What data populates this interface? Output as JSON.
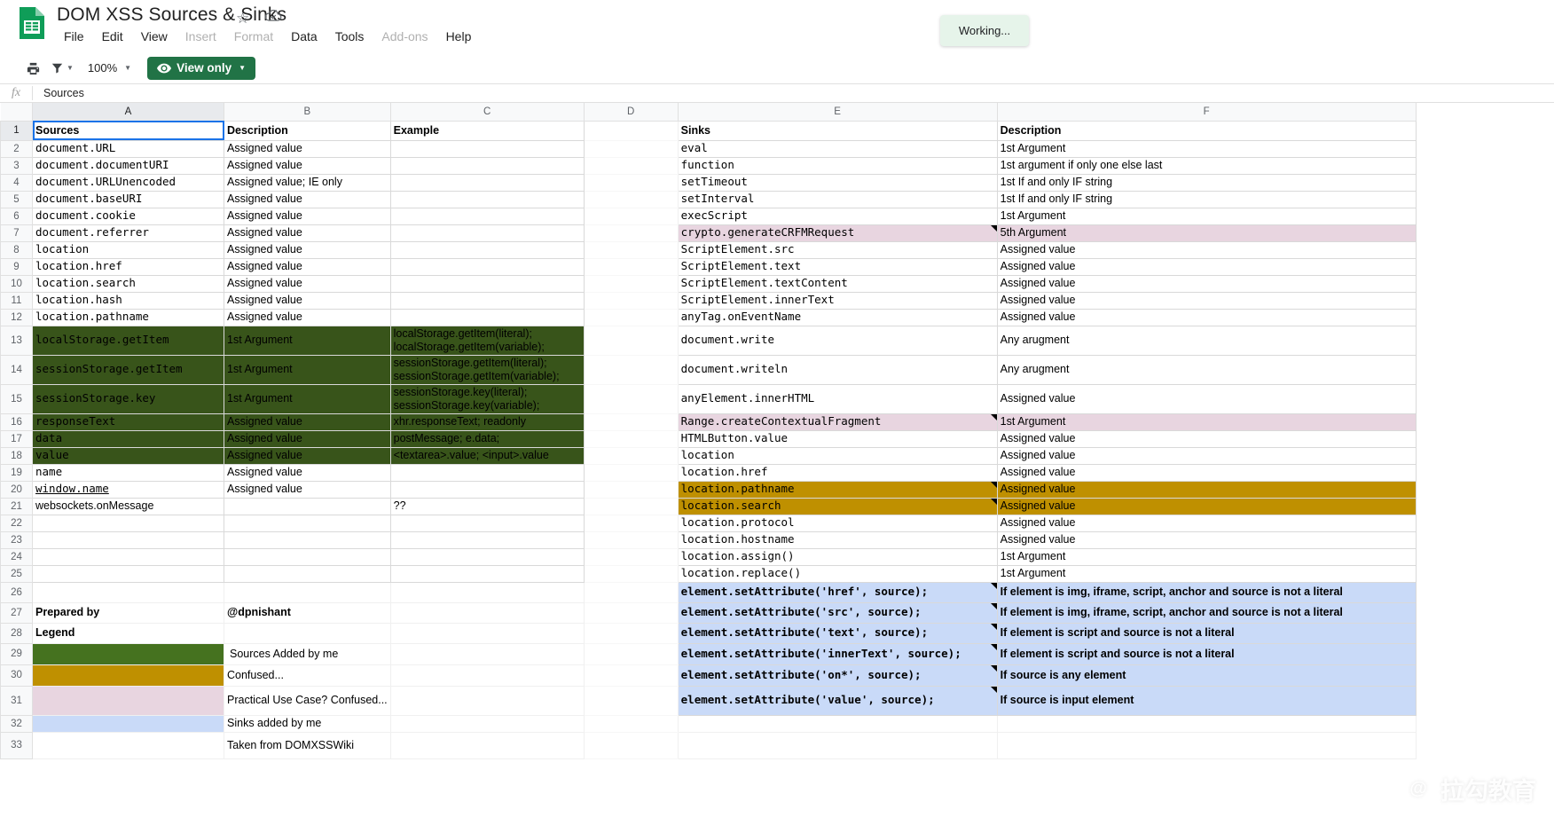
{
  "app": {
    "doc_title": "DOM XSS Sources & Sinks",
    "star_icon": "star-icon",
    "cloud_icon": "cloud-saved-icon",
    "menus": [
      {
        "label": "File",
        "disabled": false
      },
      {
        "label": "Edit",
        "disabled": false
      },
      {
        "label": "View",
        "disabled": false
      },
      {
        "label": "Insert",
        "disabled": true
      },
      {
        "label": "Format",
        "disabled": true
      },
      {
        "label": "Data",
        "disabled": false
      },
      {
        "label": "Tools",
        "disabled": false
      },
      {
        "label": "Add-ons",
        "disabled": true
      },
      {
        "label": "Help",
        "disabled": false
      }
    ]
  },
  "toolbar": {
    "print_icon": "print-icon",
    "filter_icon": "filter-icon",
    "zoom_value": "100%",
    "view_only_label": "View only",
    "view_only_icon": "eye-icon",
    "view_only_color": "#217346"
  },
  "toast": {
    "text": "Working...",
    "bg": "#e6f4ea"
  },
  "formula_bar": {
    "fx_label": "fx",
    "value": "Sources"
  },
  "watermark": {
    "text": "拉勾教育",
    "at": "@"
  },
  "grid": {
    "columns": [
      "A",
      "B",
      "C",
      "D",
      "E",
      "F"
    ],
    "selected_column": "A",
    "selected_cell": "A1",
    "row_numbers": [
      1,
      2,
      3,
      4,
      5,
      6,
      7,
      8,
      9,
      10,
      11,
      12,
      13,
      14,
      15,
      16,
      17,
      18,
      19,
      20,
      21,
      22,
      23,
      24,
      25,
      26,
      27,
      28,
      29,
      30,
      31,
      32,
      33
    ]
  },
  "colors": {
    "green_fill": "#38541a",
    "pink_fill": "#e8d5e0",
    "gold_fill": "#bf9000",
    "blue_fill": "#c9daf8",
    "legend_green": "#45721f",
    "selection_blue": "#1a73e8"
  },
  "sources_table": {
    "headers": {
      "a": "Sources",
      "b": "Description",
      "c": "Example"
    },
    "rows": [
      {
        "row": 2,
        "a": "document.URL",
        "b": "Assigned value",
        "c": "",
        "fill": "none",
        "mono": true
      },
      {
        "row": 3,
        "a": "document.documentURI",
        "b": "Assigned value",
        "c": "",
        "fill": "none",
        "mono": true
      },
      {
        "row": 4,
        "a": "document.URLUnencoded",
        "b": "Assigned value; IE only",
        "c": "",
        "fill": "none",
        "mono": true
      },
      {
        "row": 5,
        "a": "document.baseURI",
        "b": "Assigned value",
        "c": "",
        "fill": "none",
        "mono": true
      },
      {
        "row": 6,
        "a": "document.cookie",
        "b": "Assigned value",
        "c": "",
        "fill": "none",
        "mono": true
      },
      {
        "row": 7,
        "a": "document.referrer",
        "b": "Assigned value",
        "c": "",
        "fill": "none",
        "mono": true
      },
      {
        "row": 8,
        "a": "location",
        "b": "Assigned value",
        "c": "",
        "fill": "none",
        "mono": true
      },
      {
        "row": 9,
        "a": "location.href",
        "b": "Assigned value",
        "c": "",
        "fill": "none",
        "mono": true
      },
      {
        "row": 10,
        "a": "location.search",
        "b": "Assigned value",
        "c": "",
        "fill": "none",
        "mono": true
      },
      {
        "row": 11,
        "a": "location.hash",
        "b": "Assigned value",
        "c": "",
        "fill": "none",
        "mono": true
      },
      {
        "row": 12,
        "a": "location.pathname",
        "b": "Assigned value",
        "c": "",
        "fill": "none",
        "mono": true
      },
      {
        "row": 13,
        "a": "localStorage.getItem",
        "b": "1st Argument",
        "c": "localStorage.getItem(literal);\nlocalStorage.getItem(variable);",
        "fill": "green",
        "mono": true,
        "tall": true
      },
      {
        "row": 14,
        "a": "sessionStorage.getItem",
        "b": "1st Argument",
        "c": "sessionStorage.getItem(literal);\nsessionStorage.getItem(variable);",
        "fill": "green",
        "mono": true,
        "tall": true
      },
      {
        "row": 15,
        "a": "sessionStorage.key",
        "b": "1st Argument",
        "c": "sessionStorage.key(literal);\nsessionStorage.key(variable);",
        "fill": "green",
        "mono": true,
        "tall": true
      },
      {
        "row": 16,
        "a": "responseText",
        "b": "Assigned value",
        "c": "xhr.responseText; readonly",
        "fill": "green",
        "mono": true
      },
      {
        "row": 17,
        "a": "data",
        "b": "Assigned value",
        "c": "postMessage; e.data;",
        "fill": "green",
        "mono": true
      },
      {
        "row": 18,
        "a": "value",
        "b": "Assigned value",
        "c": "<textarea>.value; <input>.value",
        "fill": "green",
        "mono": true
      },
      {
        "row": 19,
        "a": "name",
        "b": "Assigned value",
        "c": "",
        "fill": "none",
        "mono": true
      },
      {
        "row": 20,
        "a": "window.name",
        "b": "Assigned value",
        "c": "",
        "fill": "none",
        "mono": true,
        "underline": true
      },
      {
        "row": 21,
        "a": "websockets.onMessage",
        "b": "",
        "c": "??",
        "fill": "none",
        "mono": false
      },
      {
        "row": 22,
        "a": "",
        "b": "",
        "c": "",
        "fill": "none"
      },
      {
        "row": 23,
        "a": "",
        "b": "",
        "c": "",
        "fill": "none"
      },
      {
        "row": 24,
        "a": "",
        "b": "",
        "c": "",
        "fill": "none"
      },
      {
        "row": 25,
        "a": "",
        "b": "",
        "c": "",
        "fill": "none"
      }
    ],
    "footer": {
      "prepared_by_label": "Prepared by",
      "prepared_by_value": "@dpnishant",
      "legend_label": "Legend"
    },
    "legend": [
      {
        "row": 29,
        "swatch": "green",
        "label": "Sources Added by me"
      },
      {
        "row": 30,
        "swatch": "gold",
        "label": "Confused..."
      },
      {
        "row": 31,
        "swatch": "pink",
        "label": "Practical Use Case? Confused..."
      },
      {
        "row": 32,
        "swatch": "blue",
        "label": "Sinks added by me"
      },
      {
        "row": 33,
        "swatch": "none",
        "label": "Taken from DOMXSSWiki"
      }
    ]
  },
  "sinks_table": {
    "headers": {
      "e": "Sinks",
      "f": "Description"
    },
    "rows": [
      {
        "row": 2,
        "e": "eval",
        "f": "1st Argument",
        "fill": "none"
      },
      {
        "row": 3,
        "e": "function",
        "f": "1st argument if only one else last",
        "fill": "none"
      },
      {
        "row": 4,
        "e": "setTimeout",
        "f": "1st If and only IF string",
        "fill": "none"
      },
      {
        "row": 5,
        "e": "setInterval",
        "f": "1st If and only IF string",
        "fill": "none"
      },
      {
        "row": 6,
        "e": "execScript",
        "f": "1st Argument",
        "fill": "none"
      },
      {
        "row": 7,
        "e": "crypto.generateCRFMRequest",
        "f": "5th Argument",
        "fill": "pink",
        "note": true
      },
      {
        "row": 8,
        "e": "ScriptElement.src",
        "f": "Assigned value",
        "fill": "none"
      },
      {
        "row": 9,
        "e": "ScriptElement.text",
        "f": "Assigned value",
        "fill": "none"
      },
      {
        "row": 10,
        "e": "ScriptElement.textContent",
        "f": "Assigned value",
        "fill": "none"
      },
      {
        "row": 11,
        "e": "ScriptElement.innerText",
        "f": "Assigned value",
        "fill": "none"
      },
      {
        "row": 12,
        "e": "anyTag.onEventName",
        "f": "Assigned value",
        "fill": "none"
      },
      {
        "row": 13,
        "e": "document.write",
        "f": "Any arugment",
        "fill": "none",
        "tall": true
      },
      {
        "row": 14,
        "e": "document.writeln",
        "f": "Any arugment",
        "fill": "none",
        "tall": true
      },
      {
        "row": 15,
        "e": "anyElement.innerHTML",
        "f": "Assigned value",
        "fill": "none",
        "tall": true
      },
      {
        "row": 16,
        "e": "Range.createContextualFragment",
        "f": "1st Argument",
        "fill": "pink",
        "note": true
      },
      {
        "row": 17,
        "e": "HTMLButton.value",
        "f": "Assigned value",
        "fill": "none"
      },
      {
        "row": 18,
        "e": "location",
        "f": "Assigned value",
        "fill": "none"
      },
      {
        "row": 19,
        "e": "location.href",
        "f": "Assigned value",
        "fill": "none"
      },
      {
        "row": 20,
        "e": "location.pathname",
        "f": "Assigned value",
        "fill": "gold",
        "note": true
      },
      {
        "row": 21,
        "e": "location.search",
        "f": "Assigned value",
        "fill": "gold",
        "note": true
      },
      {
        "row": 22,
        "e": "location.protocol",
        "f": "Assigned value",
        "fill": "none"
      },
      {
        "row": 23,
        "e": "location.hostname",
        "f": "Assigned value",
        "fill": "none"
      },
      {
        "row": 24,
        "e": "location.assign()",
        "f": "1st Argument",
        "fill": "none"
      },
      {
        "row": 25,
        "e": "location.replace()",
        "f": "1st Argument",
        "fill": "none"
      },
      {
        "row": 26,
        "e": "element.setAttribute('href', source);",
        "f": "If element is img, iframe, script, anchor and source is not a literal",
        "fill": "blue",
        "note": true
      },
      {
        "row": 27,
        "e": "element.setAttribute('src', source);",
        "f": "If element is img, iframe, script, anchor and source is not a literal",
        "fill": "blue",
        "note": true
      },
      {
        "row": 28,
        "e": "element.setAttribute('text', source);",
        "f": "If element is script and source is not a literal",
        "fill": "blue",
        "note": true
      },
      {
        "row": 29,
        "e": "element.setAttribute('innerText', source);",
        "f": "If element is script and source is not a literal",
        "fill": "blue",
        "note": true
      },
      {
        "row": 30,
        "e": "element.setAttribute('on*', source);",
        "f": "If source is any element",
        "fill": "blue",
        "note": true
      },
      {
        "row": 31,
        "e": "element.setAttribute('value', source);",
        "f": "If source is input element",
        "fill": "blue",
        "note": true
      },
      {
        "row": 32,
        "e": "",
        "f": "",
        "fill": "none"
      },
      {
        "row": 33,
        "e": "",
        "f": "",
        "fill": "none"
      }
    ]
  }
}
